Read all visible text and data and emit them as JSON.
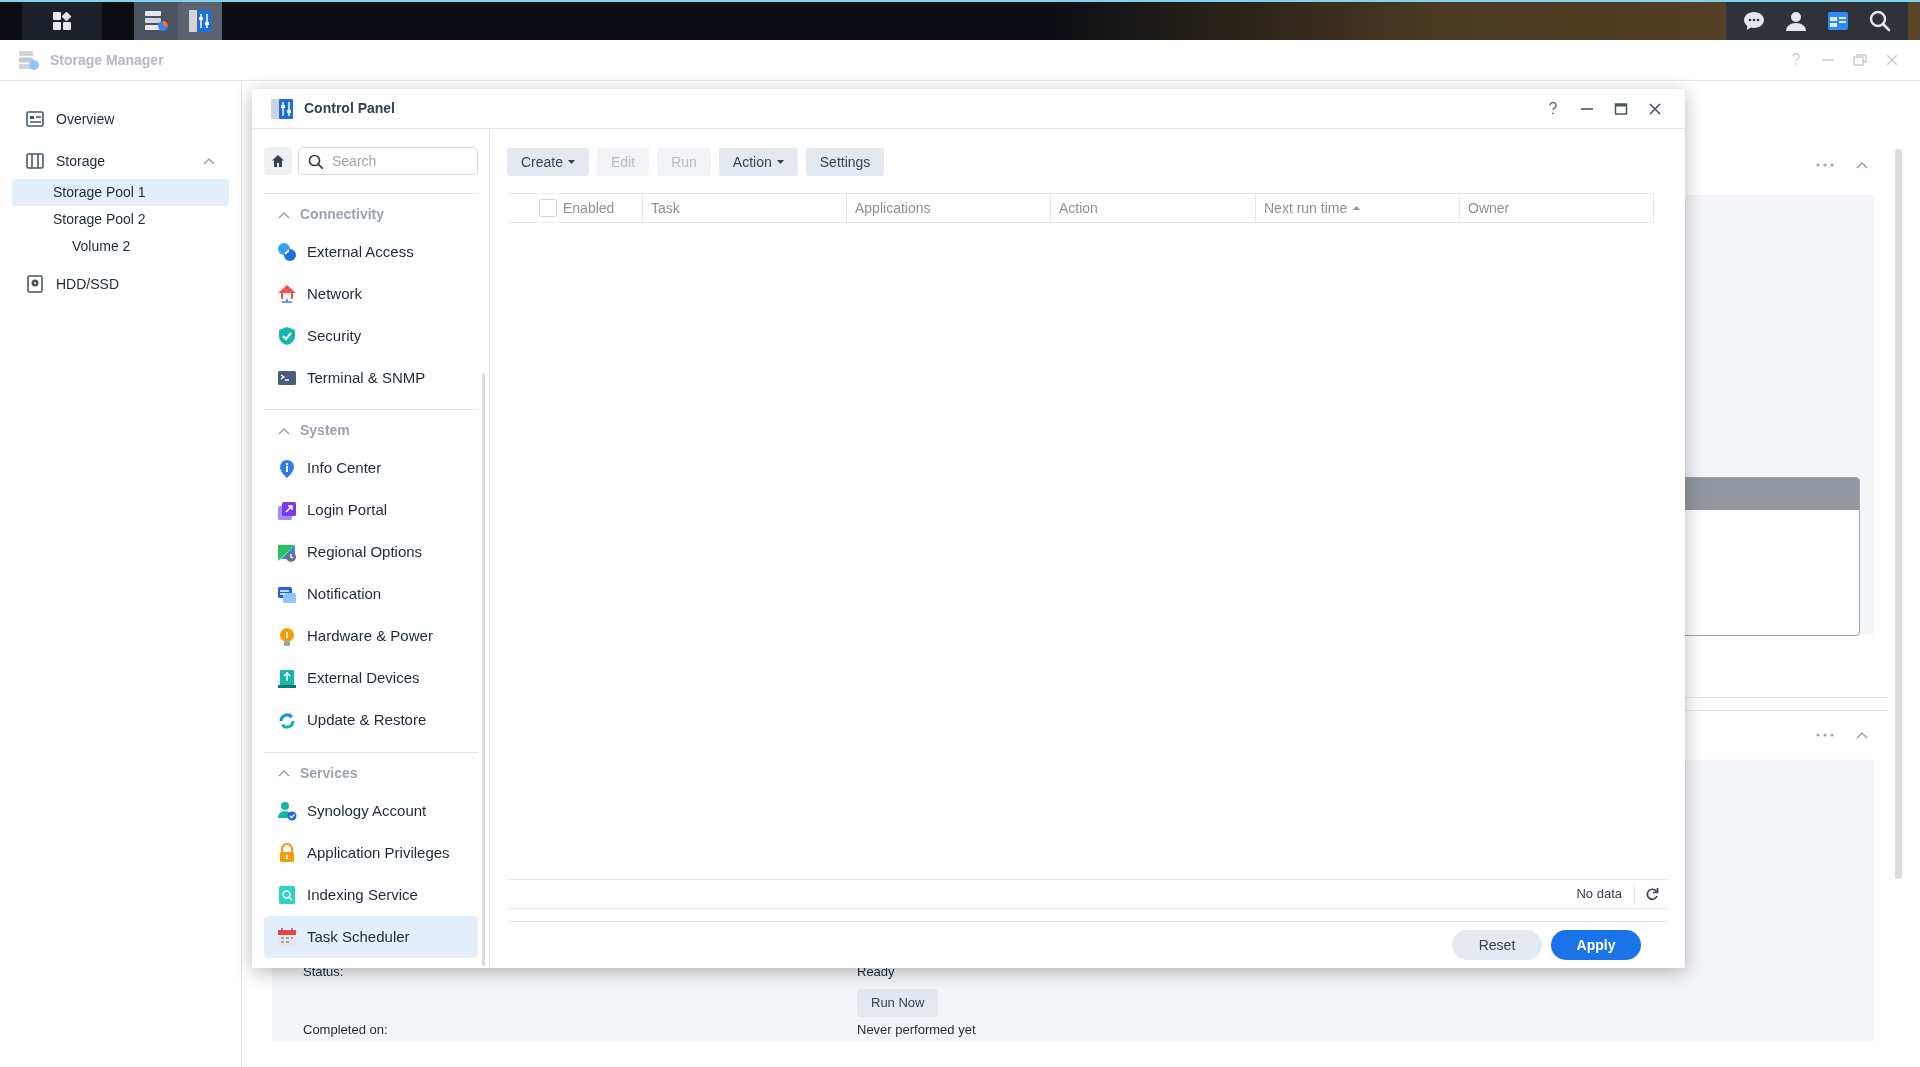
{
  "storage_manager": {
    "title": "Storage Manager",
    "sidebar": [
      {
        "label": "Overview",
        "selected": false
      },
      {
        "label": "Storage",
        "selected": false,
        "expanded": true,
        "children": [
          {
            "label": "Storage Pool 1",
            "selected": true
          },
          {
            "label": "Storage Pool 2",
            "selected": false,
            "children": [
              {
                "label": "Volume 2",
                "selected": false
              }
            ]
          }
        ]
      },
      {
        "label": "HDD/SSD",
        "selected": false
      }
    ],
    "details": [
      {
        "label": "Status:",
        "value": "Ready",
        "action": "Run Now"
      },
      {
        "label": "Completed on:",
        "value": "Never performed yet"
      }
    ]
  },
  "control_panel": {
    "title": "Control Panel",
    "search": {
      "placeholder": "Search"
    },
    "sections": [
      {
        "title": "Connectivity",
        "expanded": true,
        "items": [
          {
            "label": "External Access",
            "selected": false
          },
          {
            "label": "Network",
            "selected": false
          },
          {
            "label": "Security",
            "selected": false
          },
          {
            "label": "Terminal & SNMP",
            "selected": false
          }
        ]
      },
      {
        "title": "System",
        "expanded": true,
        "items": [
          {
            "label": "Info Center",
            "selected": false
          },
          {
            "label": "Login Portal",
            "selected": false
          },
          {
            "label": "Regional Options",
            "selected": false
          },
          {
            "label": "Notification",
            "selected": false
          },
          {
            "label": "Hardware & Power",
            "selected": false
          },
          {
            "label": "External Devices",
            "selected": false
          },
          {
            "label": "Update & Restore",
            "selected": false
          }
        ]
      },
      {
        "title": "Services",
        "expanded": true,
        "items": [
          {
            "label": "Synology Account",
            "selected": false
          },
          {
            "label": "Application Privileges",
            "selected": false
          },
          {
            "label": "Indexing Service",
            "selected": false
          },
          {
            "label": "Task Scheduler",
            "selected": true
          }
        ]
      }
    ],
    "toolbar": [
      {
        "label": "Create",
        "kind": "dropdown",
        "disabled": false
      },
      {
        "label": "Edit",
        "kind": "button",
        "disabled": true
      },
      {
        "label": "Run",
        "kind": "button",
        "disabled": true
      },
      {
        "label": "Action",
        "kind": "dropdown",
        "disabled": false
      },
      {
        "label": "Settings",
        "kind": "button",
        "disabled": false
      }
    ],
    "table": {
      "select_all_checked": false,
      "columns": [
        {
          "label": "Enabled",
          "sort_ascending": false
        },
        {
          "label": "Task",
          "sort_ascending": false
        },
        {
          "label": "Applications",
          "sort_ascending": false
        },
        {
          "label": "Action",
          "sort_ascending": false
        },
        {
          "label": "Next run time",
          "sort_ascending": true
        },
        {
          "label": "Owner",
          "sort_ascending": false
        }
      ]
    },
    "status": "No data",
    "buttons": [
      {
        "label": "Reset",
        "kind": "secondary"
      },
      {
        "label": "Apply",
        "kind": "primary"
      }
    ]
  }
}
